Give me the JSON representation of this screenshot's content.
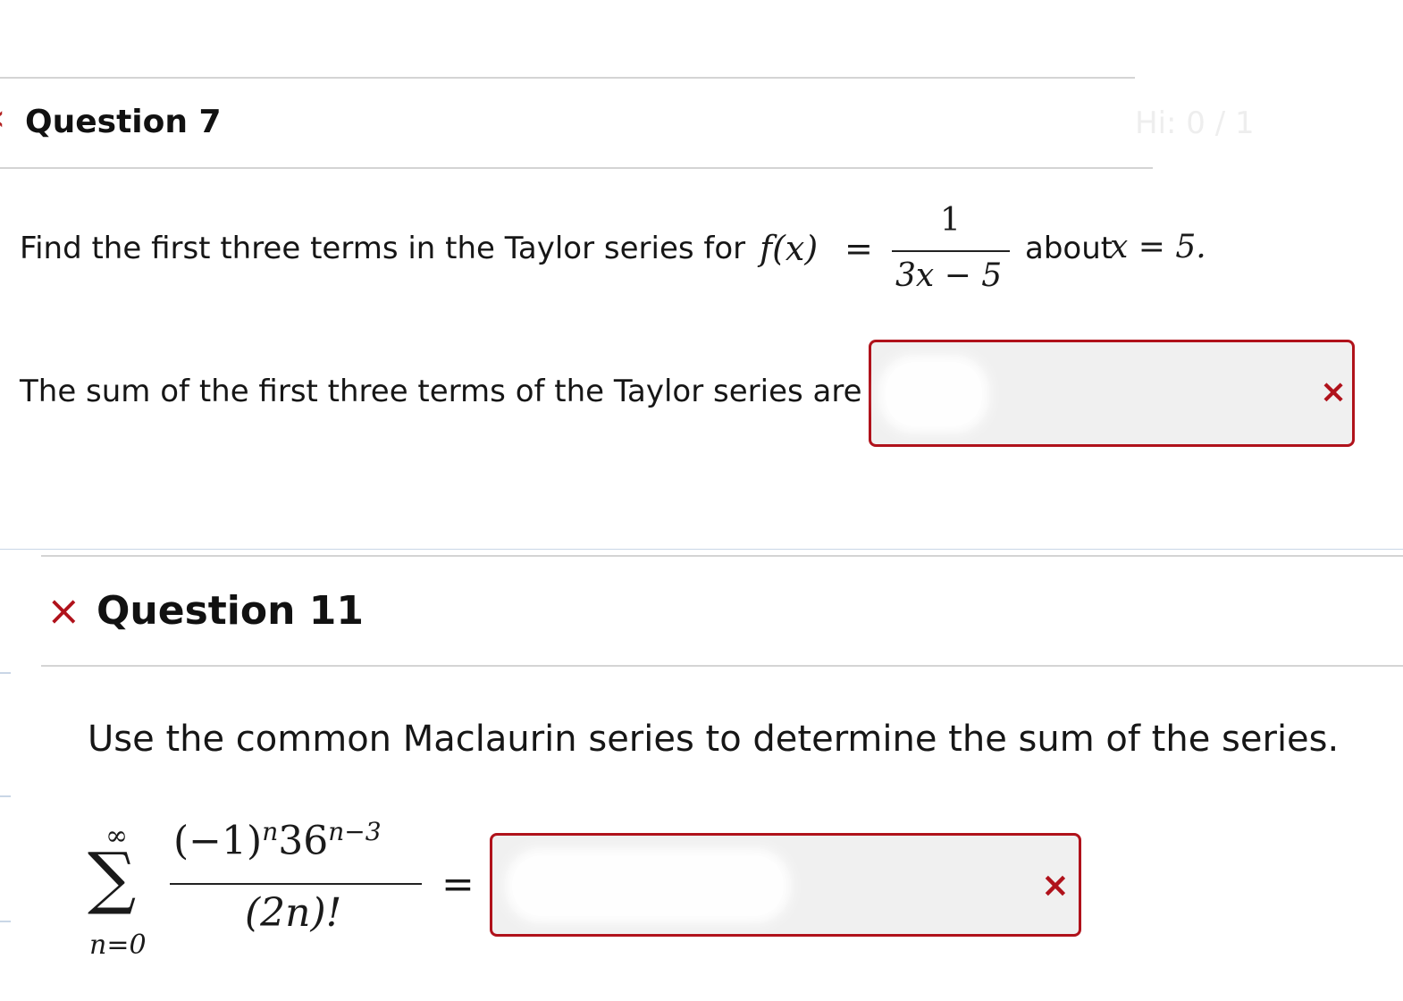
{
  "question7": {
    "title": "Question 7",
    "faded_header_text": "Hi: 0 / 1",
    "prompt_prefix": "Find the first three terms in the Taylor series for",
    "f_of_x": "f(x)",
    "equals": "=",
    "numerator": "1",
    "denominator": "3x − 5",
    "about_text": "about",
    "about_condition": "x = 5.",
    "answer_label": "The sum of the first three terms of the Taylor series are",
    "answer_value": "",
    "status": "incorrect",
    "status_icon": "×"
  },
  "question11": {
    "title": "Question 11",
    "status_icon": "×",
    "prompt": "Use the common Maclaurin series to determine the sum of the series.",
    "sum_upper": "∞",
    "sum_symbol": "∑",
    "sum_lower": "n=0",
    "numerator_base": "(−1)",
    "numerator_exp1": "n",
    "numerator_base2": "36",
    "numerator_exp2": "n−3",
    "denominator": "(2n)!",
    "equals": "=",
    "answer_value": "",
    "answer_status": "incorrect",
    "answer_icon": "×"
  },
  "colors": {
    "incorrect": "#b0121b",
    "answer_bg": "#f0f0f0",
    "divider": "#d4d4d4"
  }
}
